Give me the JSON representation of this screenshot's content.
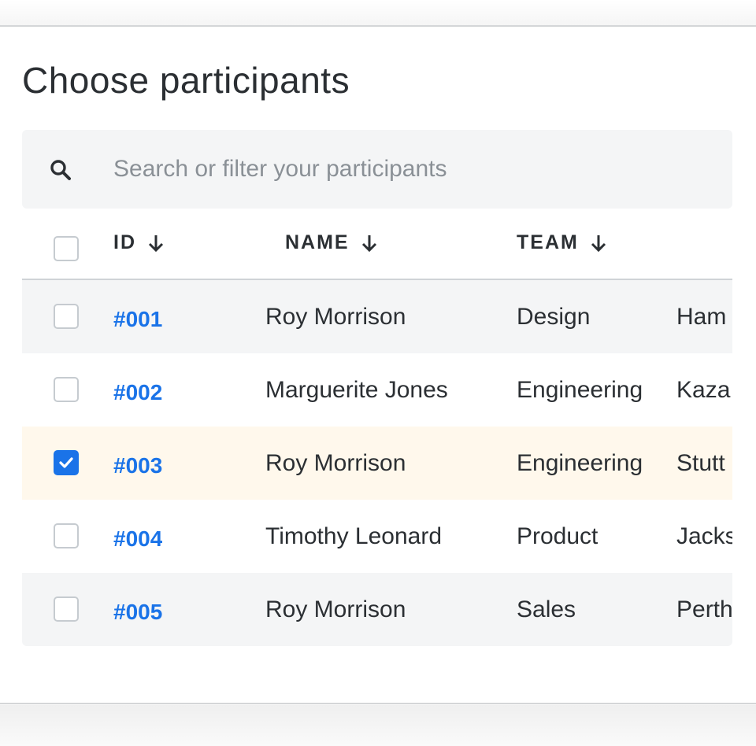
{
  "page": {
    "title": "Choose participants"
  },
  "search": {
    "placeholder": "Search or filter your participants",
    "value": "",
    "icon": "search-icon"
  },
  "table": {
    "columns": [
      {
        "label": "ID",
        "sort": "descending"
      },
      {
        "label": "NAME",
        "sort": "descending"
      },
      {
        "label": "TEAM",
        "sort": "descending"
      }
    ],
    "rows": [
      {
        "id": "#001",
        "name": "Roy Morrison",
        "team": "Design",
        "location": "Ham",
        "checked": false
      },
      {
        "id": "#002",
        "name": "Marguerite Jones",
        "team": "Engineering",
        "location": "Kaza",
        "checked": false
      },
      {
        "id": "#003",
        "name": "Roy Morrison",
        "team": "Engineering",
        "location": "Stutt",
        "checked": true
      },
      {
        "id": "#004",
        "name": "Timothy Leonard",
        "team": "Product",
        "location": "Jacks",
        "checked": false
      },
      {
        "id": "#005",
        "name": "Roy Morrison",
        "team": "Sales",
        "location": "Perth",
        "checked": false
      }
    ]
  },
  "colors": {
    "accent": "#1a73e8",
    "selected_row": "#fff8ec",
    "alt_row": "#f4f5f6"
  }
}
